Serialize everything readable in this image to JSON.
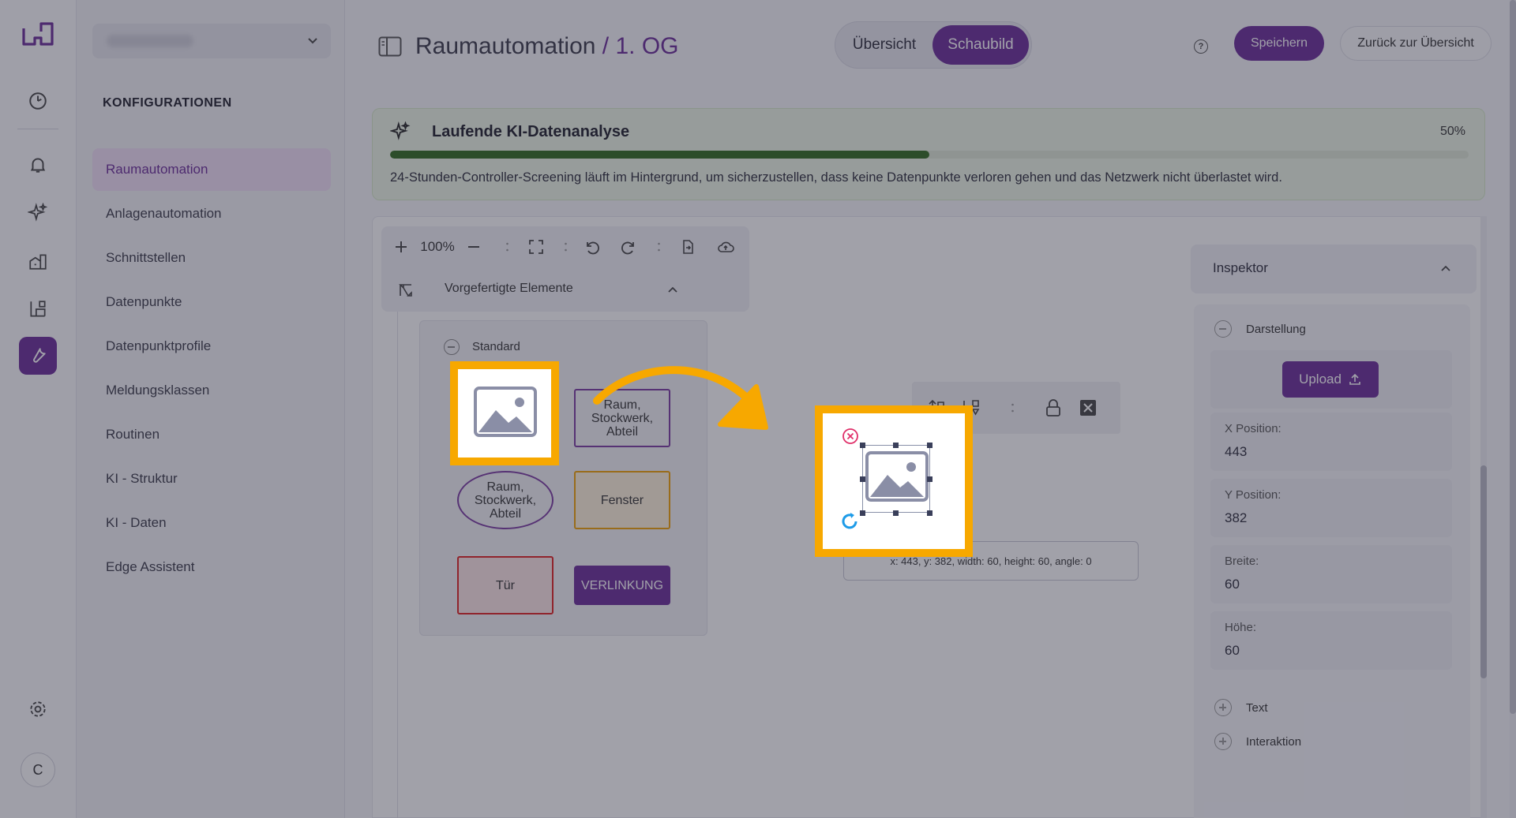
{
  "rail": {
    "icons": [
      "dashboard-icon",
      "bell-icon",
      "sparkle-icon",
      "building-icon",
      "floorplan-icon",
      "wrench-icon",
      "gear-icon"
    ],
    "avatar_initial": "C",
    "accent": "#6a2c98"
  },
  "sidebar": {
    "heading": "KONFIGURATIONEN",
    "items": [
      {
        "label": "Raumautomation",
        "active": true
      },
      {
        "label": "Anlagenautomation"
      },
      {
        "label": "Schnittstellen"
      },
      {
        "label": "Datenpunkte"
      },
      {
        "label": "Datenpunktprofile"
      },
      {
        "label": "Meldungsklassen"
      },
      {
        "label": "Routinen"
      },
      {
        "label": "KI - Struktur"
      },
      {
        "label": "KI - Daten"
      },
      {
        "label": "Edge Assistent"
      }
    ]
  },
  "header": {
    "title_main": "Raumautomation",
    "title_accent": " / 1. OG",
    "tabs": [
      {
        "label": "Übersicht"
      },
      {
        "label": "Schaubild",
        "active": true
      }
    ],
    "help_label": "?",
    "save_label": "Speichern",
    "back_label": "Zurück zur Übersicht"
  },
  "ai_banner": {
    "title": "Laufende KI-Datenanalyse",
    "percent_label": "50%",
    "progress": 0.5,
    "description": "24-Stunden-Controller-Screening läuft im Hintergrund, um sicherzustellen, dass keine Datenpunkte verloren gehen und das Netzwerk nicht überlastet wird.",
    "bar_color": "#2f6a1e"
  },
  "toolbar": {
    "zoom_label": "100%",
    "prefab_label": "Vorgefertigte Elemente"
  },
  "palette": {
    "group_label": "Standard",
    "elements": {
      "rect_label": "Raum,\nStockwerk,\nAbteil",
      "ellipse_label": "Raum,\nStockwerk,\nAbteil",
      "window_label": "Fenster",
      "door_label": "Tür",
      "link_label": "VERLINKUNG"
    }
  },
  "canvas": {
    "coords_text": "x: 443, y: 382, width: 60, height: 60, angle: 0",
    "highlight_color": "#f7a800"
  },
  "inspector": {
    "title": "Inspektor",
    "section_display": "Darstellung",
    "upload_label": "Upload",
    "fields": [
      {
        "label": "X Position:",
        "value": "443"
      },
      {
        "label": "Y Position:",
        "value": "382"
      },
      {
        "label": "Breite:",
        "value": "60"
      },
      {
        "label": "Höhe:",
        "value": "60"
      }
    ],
    "section_text": "Text",
    "section_interaction": "Interaktion"
  }
}
